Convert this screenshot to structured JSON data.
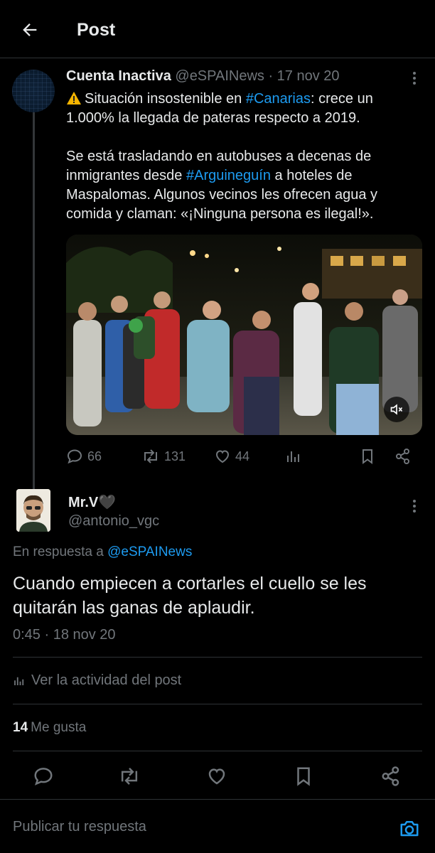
{
  "header": {
    "title": "Post"
  },
  "quoted_tweet": {
    "author_name": "Cuenta Inactiva",
    "meta": " @eSPAINews · 17 nov 20",
    "line1_pre": "Situación insostenible en ",
    "hashtag1": "#Canarias",
    "line1_post": ": crece un 1.000% la llegada de pateras respecto a 2019.",
    "para2_pre": "Se está trasladando en autobuses a decenas de inmigrantes desde ",
    "hashtag2": "#Arguineguín",
    "para2_post": " a hoteles de Maspalomas. Algunos vecinos les ofrecen agua y comida y claman: «¡Ninguna persona es ilegal!».",
    "replies": "66",
    "retweets": "131",
    "likes": "44"
  },
  "reply_tweet": {
    "author_name": "Mr.V🖤",
    "handle": "@antonio_vgc",
    "reply_prefix": "En respuesta a ",
    "reply_target": "@eSPAINews",
    "text": "Cuando empiecen a cortarles el cuello se les quitarán las ganas de aplaudir.",
    "timestamp": "0:45 · 18 nov 20",
    "activity_label": "Ver la actividad del post",
    "like_count": "14",
    "like_label": "Me gusta"
  },
  "composer": {
    "placeholder": "Publicar tu respuesta"
  },
  "colors": {
    "background": "#000000",
    "accent": "#1d9bf0",
    "muted": "#71767b",
    "text": "#e7e9ea",
    "border": "#2f3336"
  },
  "icons": [
    "back-arrow-icon",
    "more-icon",
    "warning-icon",
    "mute-icon",
    "reply-icon",
    "retweet-icon",
    "like-icon",
    "views-icon",
    "bookmark-icon",
    "share-icon",
    "camera-icon"
  ]
}
